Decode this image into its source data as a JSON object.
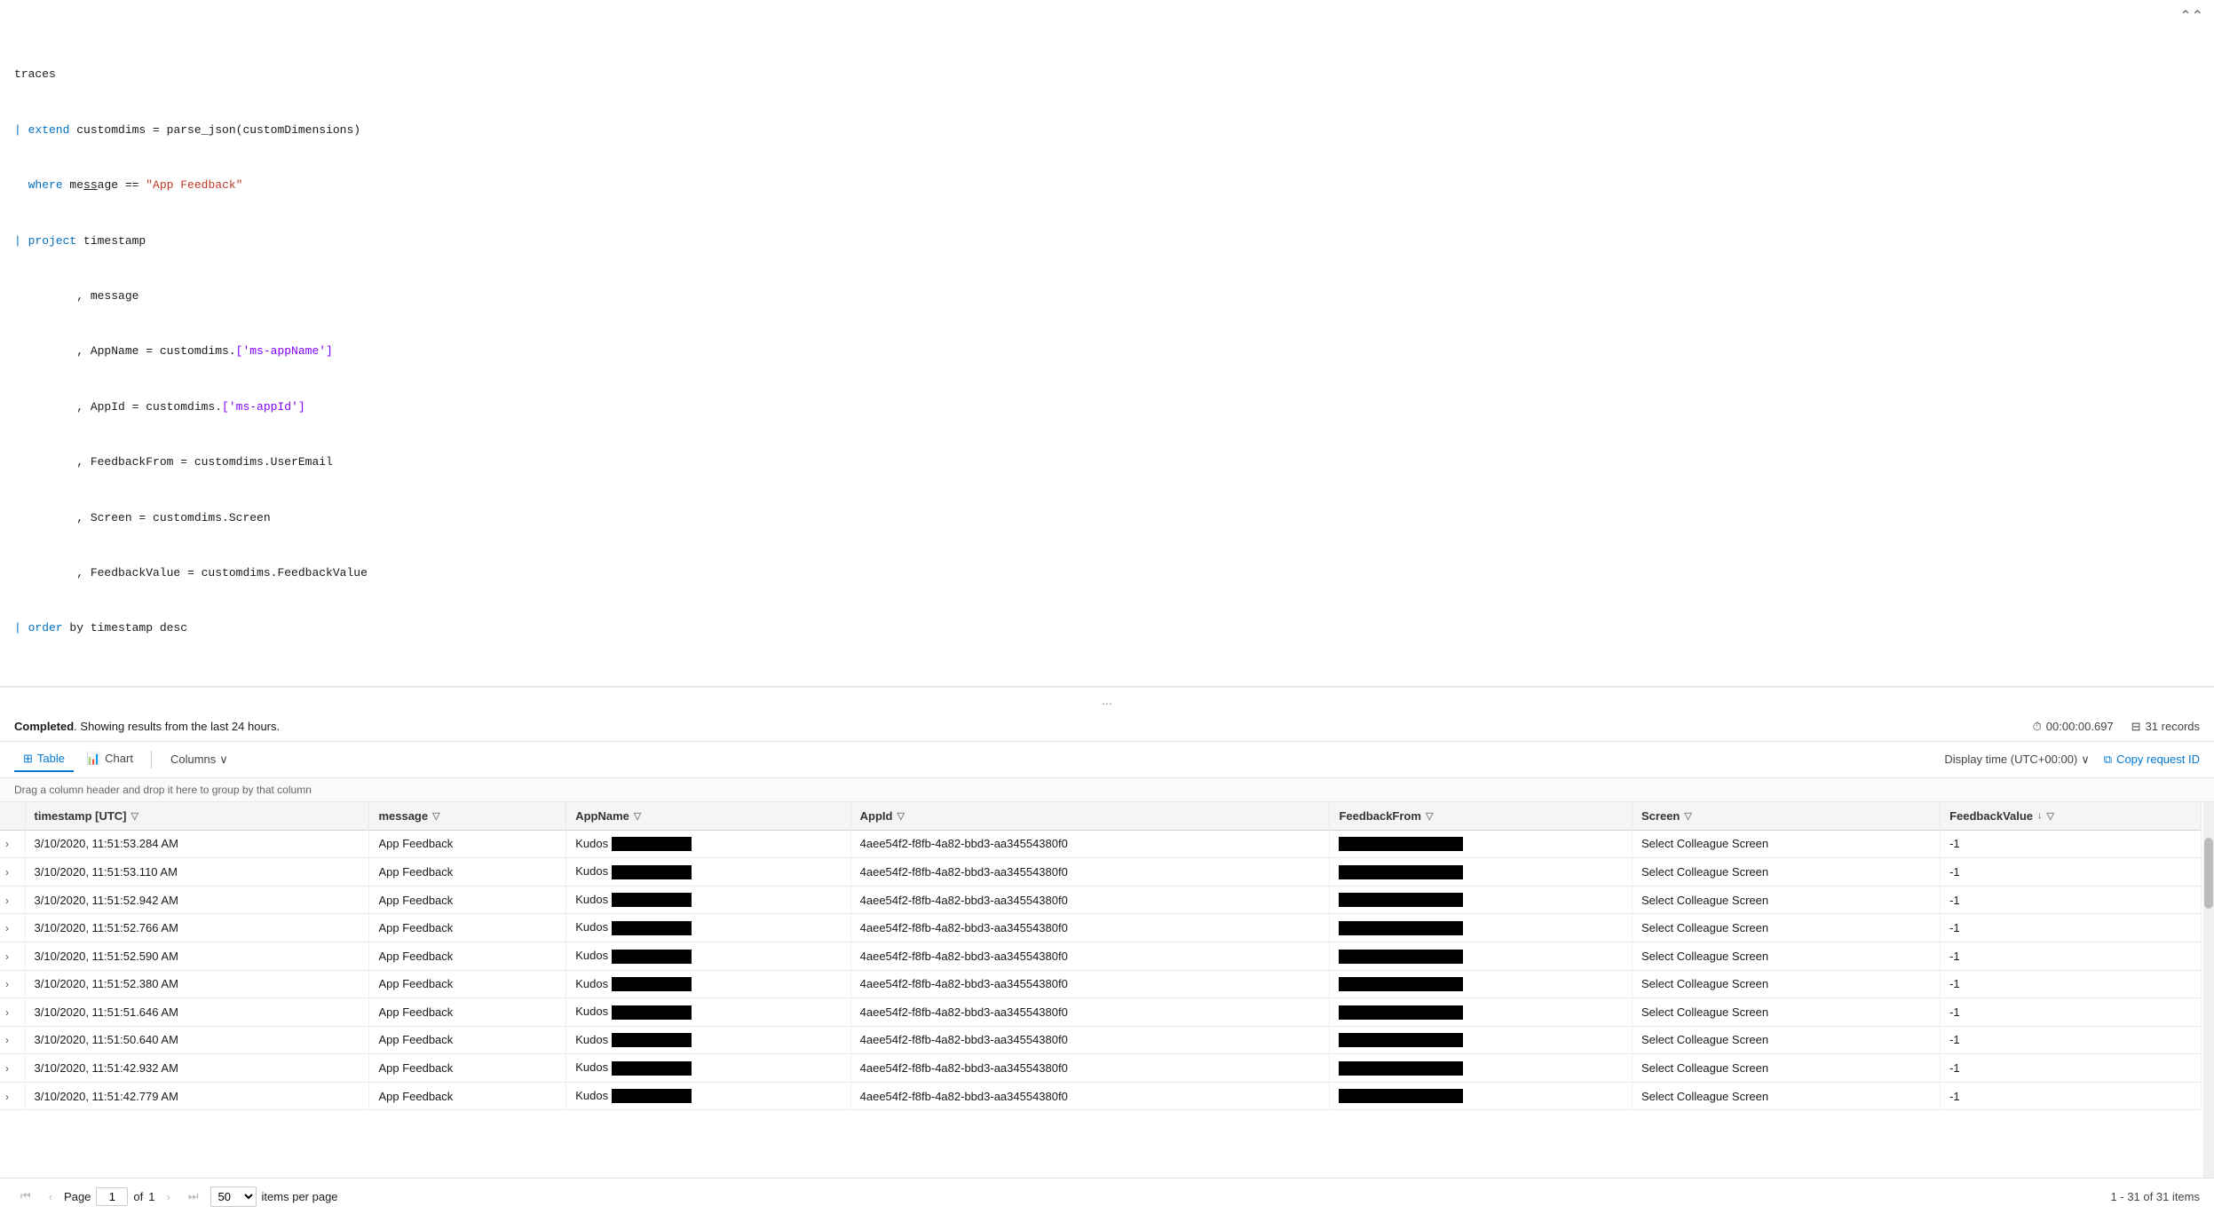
{
  "editor": {
    "lines": [
      {
        "id": 1,
        "text": "traces",
        "type": "default"
      },
      {
        "id": 2,
        "text": "| extend customdims = parse_json(customDimensions)",
        "keyword": "extend",
        "kw_end": 8
      },
      {
        "id": 3,
        "text": "  where message == \"App Feedback\"",
        "keyword": "where",
        "string": "\"App Feedback\""
      },
      {
        "id": 4,
        "text": "| project timestamp",
        "keyword": "project"
      },
      {
        "id": 5,
        "text": "         , message"
      },
      {
        "id": 6,
        "text": "         , AppName = customdims.['ms-appName']",
        "bracket": "['ms-appName']"
      },
      {
        "id": 7,
        "text": "         , AppId = customdims.['ms-appId']",
        "bracket": "['ms-appId']"
      },
      {
        "id": 8,
        "text": "         , FeedbackFrom = customdims.UserEmail"
      },
      {
        "id": 9,
        "text": "         , Screen = customdims.Screen"
      },
      {
        "id": 10,
        "text": "         , FeedbackValue = customdims.FeedbackValue"
      },
      {
        "id": 11,
        "text": "| order by timestamp desc",
        "keyword": "order"
      }
    ],
    "collapse_icon": "⌃⌃"
  },
  "divider": "...",
  "results": {
    "status_bold": "Completed",
    "status_text": ". Showing results from the last 24 hours.",
    "duration": "00:00:00.697",
    "records": "31 records"
  },
  "toolbar": {
    "tab_table": "Table",
    "tab_chart": "Chart",
    "columns_btn": "Columns",
    "display_time": "Display time (UTC+00:00)",
    "copy_request": "Copy request ID"
  },
  "drag_hint": "Drag a column header and drop it here to group by that column",
  "table": {
    "columns": [
      {
        "id": "expand",
        "label": ""
      },
      {
        "id": "timestamp",
        "label": "timestamp [UTC]",
        "filter": true
      },
      {
        "id": "message",
        "label": "message",
        "filter": true
      },
      {
        "id": "appname",
        "label": "AppName",
        "filter": true
      },
      {
        "id": "appid",
        "label": "AppId",
        "filter": true
      },
      {
        "id": "feedbackfrom",
        "label": "FeedbackFrom",
        "filter": true
      },
      {
        "id": "screen",
        "label": "Screen",
        "filter": true
      },
      {
        "id": "feedbackvalue",
        "label": "FeedbackValue",
        "filter": true,
        "sort": "desc"
      }
    ],
    "rows": [
      {
        "timestamp": "3/10/2020, 11:51:53.284 AM",
        "message": "App Feedback",
        "appname": "Kudos",
        "appid": "4aee54f2-f8fb-4a82-bbd3-aa34554380f0",
        "feedbackfrom": "REDACTED",
        "screen": "Select Colleague Screen",
        "feedbackvalue": "-1"
      },
      {
        "timestamp": "3/10/2020, 11:51:53.110 AM",
        "message": "App Feedback",
        "appname": "Kudos",
        "appid": "4aee54f2-f8fb-4a82-bbd3-aa34554380f0",
        "feedbackfrom": "REDACTED",
        "screen": "Select Colleague Screen",
        "feedbackvalue": "-1"
      },
      {
        "timestamp": "3/10/2020, 11:51:52.942 AM",
        "message": "App Feedback",
        "appname": "Kudos",
        "appid": "4aee54f2-f8fb-4a82-bbd3-aa34554380f0",
        "feedbackfrom": "REDACTED",
        "screen": "Select Colleague Screen",
        "feedbackvalue": "-1"
      },
      {
        "timestamp": "3/10/2020, 11:51:52.766 AM",
        "message": "App Feedback",
        "appname": "Kudos",
        "appid": "4aee54f2-f8fb-4a82-bbd3-aa34554380f0",
        "feedbackfrom": "REDACTED",
        "screen": "Select Colleague Screen",
        "feedbackvalue": "-1"
      },
      {
        "timestamp": "3/10/2020, 11:51:52.590 AM",
        "message": "App Feedback",
        "appname": "Kudos",
        "appid": "4aee54f2-f8fb-4a82-bbd3-aa34554380f0",
        "feedbackfrom": "REDACTED",
        "screen": "Select Colleague Screen",
        "feedbackvalue": "-1"
      },
      {
        "timestamp": "3/10/2020, 11:51:52.380 AM",
        "message": "App Feedback",
        "appname": "Kudos",
        "appid": "4aee54f2-f8fb-4a82-bbd3-aa34554380f0",
        "feedbackfrom": "REDACTED",
        "screen": "Select Colleague Screen",
        "feedbackvalue": "-1"
      },
      {
        "timestamp": "3/10/2020, 11:51:51.646 AM",
        "message": "App Feedback",
        "appname": "Kudos",
        "appid": "4aee54f2-f8fb-4a82-bbd3-aa34554380f0",
        "feedbackfrom": "REDACTED",
        "screen": "Select Colleague Screen",
        "feedbackvalue": "-1"
      },
      {
        "timestamp": "3/10/2020, 11:51:50.640 AM",
        "message": "App Feedback",
        "appname": "Kudos",
        "appid": "4aee54f2-f8fb-4a82-bbd3-aa34554380f0",
        "feedbackfrom": "REDACTED",
        "screen": "Select Colleague Screen",
        "feedbackvalue": "-1"
      },
      {
        "timestamp": "3/10/2020, 11:51:42.932 AM",
        "message": "App Feedback",
        "appname": "Kudos",
        "appid": "4aee54f2-f8fb-4a82-bbd3-aa34554380f0",
        "feedbackfrom": "REDACTED",
        "screen": "Select Colleague Screen",
        "feedbackvalue": "-1"
      },
      {
        "timestamp": "3/10/2020, 11:51:42.779 AM",
        "message": "App Feedback",
        "appname": "Kudos",
        "appid": "4aee54f2-f8fb-4a82-bbd3-aa34554380f0",
        "feedbackfrom": "REDACTED",
        "screen": "Select Colleague Screen",
        "feedbackvalue": "-1"
      }
    ]
  },
  "pagination": {
    "page_label": "Page",
    "current_page": "1",
    "of_label": "of",
    "total_pages": "1",
    "per_page": "50",
    "summary": "1 - 31 of 31 items"
  }
}
